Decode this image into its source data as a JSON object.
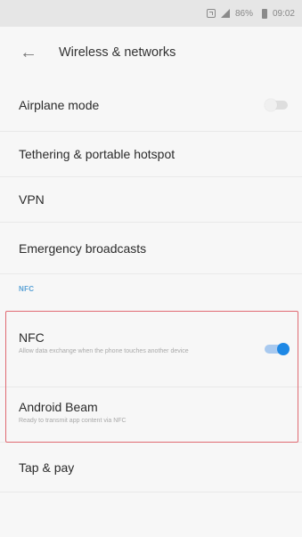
{
  "status_bar": {
    "battery": "86%",
    "time": "09:02",
    "icons": [
      "nfc-icon",
      "signal-icon",
      "battery-icon"
    ]
  },
  "app_bar": {
    "back_icon": "arrow-left-icon",
    "title": "Wireless & networks"
  },
  "items": {
    "airplane_mode": {
      "label": "Airplane mode",
      "toggle": "off"
    },
    "tethering": {
      "label": "Tethering & portable hotspot"
    },
    "vpn": {
      "label": "VPN"
    },
    "emergency": {
      "label": "Emergency broadcasts"
    }
  },
  "nfc_section": {
    "header": "NFC",
    "nfc": {
      "label": "NFC",
      "summary": "Allow data exchange when the phone touches another device",
      "toggle": "on"
    },
    "android_beam": {
      "label": "Android Beam",
      "summary": "Ready to transmit app content via NFC"
    },
    "tap_pay": {
      "label": "Tap & pay"
    }
  },
  "colors": {
    "accent": "#1e88e5",
    "section_header": "#5aa2d6",
    "highlight_border": "#e06a72"
  }
}
